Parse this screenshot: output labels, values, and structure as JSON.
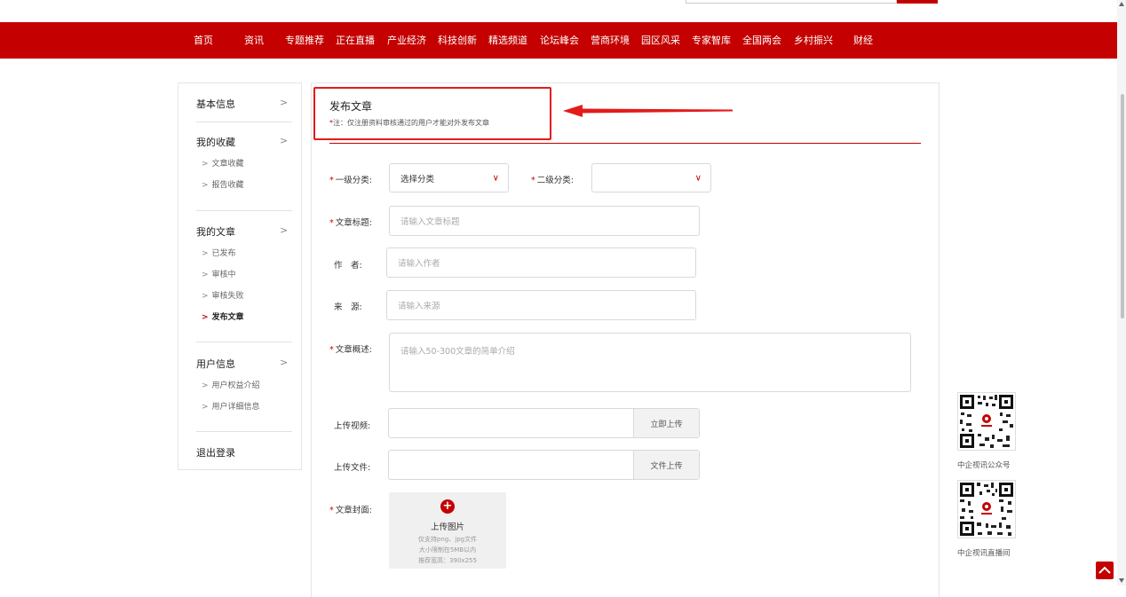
{
  "nav": {
    "items": [
      "首页",
      "资讯",
      "专题推荐",
      "正在直播",
      "产业经济",
      "科技创新",
      "精选频道",
      "论坛峰会",
      "营商环境",
      "园区风采",
      "专家智库",
      "全国两会",
      "乡村振兴",
      "财经"
    ]
  },
  "sidebar": {
    "basic": {
      "title": "基本信息",
      "chev": ">"
    },
    "favorites": {
      "title": "我的收藏",
      "chev": ">",
      "items": [
        "文章收藏",
        "报告收藏"
      ]
    },
    "articles": {
      "title": "我的文章",
      "chev": ">",
      "items": [
        "已发布",
        "审核中",
        "审核失败",
        "发布文章"
      ],
      "active": "发布文章"
    },
    "user": {
      "title": "用户信息",
      "chev": ">",
      "items": [
        "用户权益介绍",
        "用户详细信息"
      ]
    },
    "logout": "退出登录",
    "arrow": ">"
  },
  "main": {
    "title": "发布文章",
    "note_star": "*",
    "note": "注：仅注册资料审核通过的用户才能对外发布文章"
  },
  "form": {
    "required_mark": "*",
    "cat1_label": "一级分类:",
    "cat1_value": "选择分类",
    "cat2_label": "二级分类:",
    "cat2_value": "",
    "title_label": "文章标题:",
    "title_placeholder": "请输入文章标题",
    "author_label": "作　者:",
    "author_placeholder": "请输入作者",
    "source_label": "来　源:",
    "source_placeholder": "请输入来源",
    "summary_label": "文章概述:",
    "summary_placeholder": "请输入50-300文章的简单介绍",
    "video_label": "上传视频:",
    "video_button": "立即上传",
    "file_label": "上传文件:",
    "file_button": "文件上传",
    "cover_label": "文章封面:",
    "cover_title": "上传图片",
    "cover_hint1": "仅支持png、jpg文件",
    "cover_hint2": "大小限制在5MB以内",
    "cover_hint3": "推荐宽高：390x255",
    "chevron": "∨",
    "plus": "+"
  },
  "qrcodes": {
    "wechat_label": "中企视讯公众号",
    "live_label": "中企视讯直播间"
  },
  "colors": {
    "brand_red": "#c40000",
    "annotation_red": "#e31b1b"
  },
  "icons": {
    "back_to_top": "chevron-up-icon",
    "plus": "plus-circle-icon",
    "select": "chevron-down-icon"
  }
}
